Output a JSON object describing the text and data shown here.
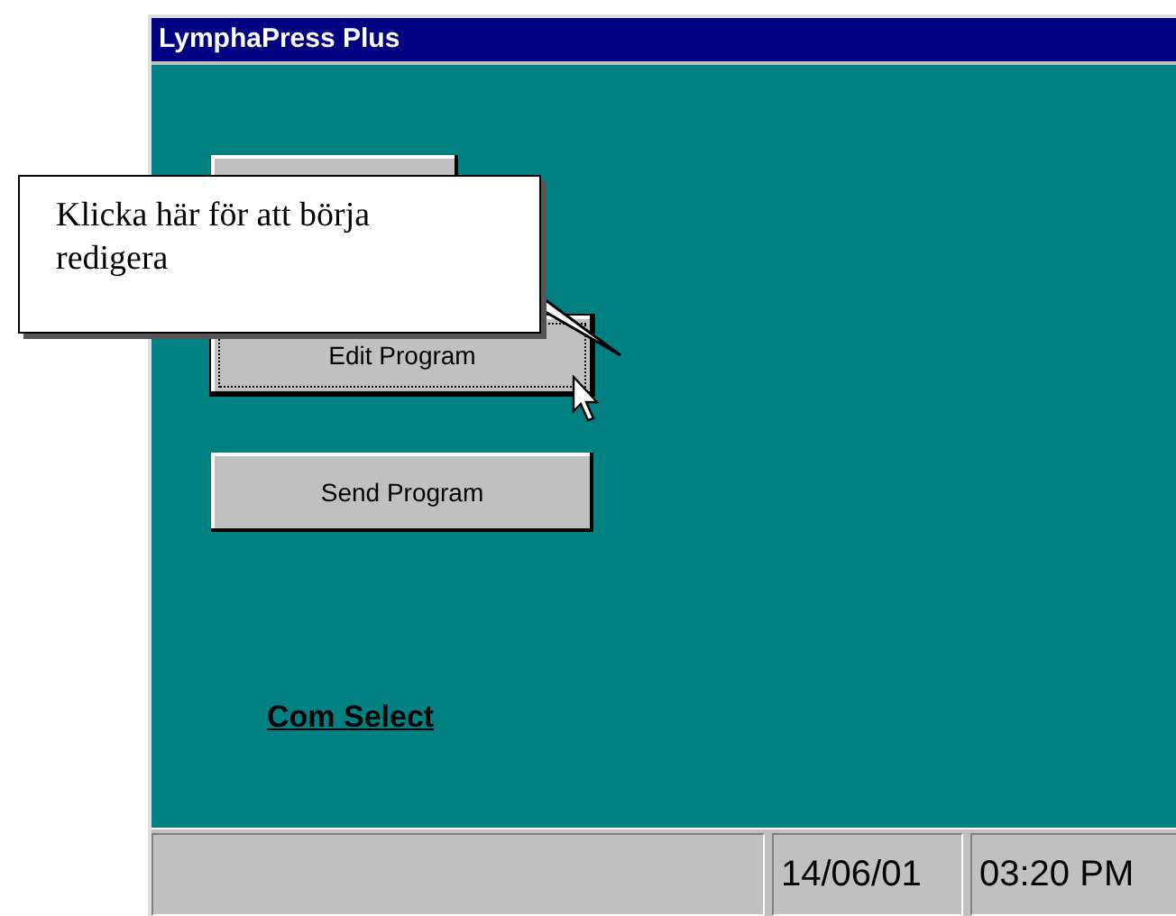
{
  "window": {
    "title": "LymphaPress Plus"
  },
  "buttons": [
    {
      "focused": false
    },
    {
      "label": "Edit Program",
      "focused": true
    },
    {
      "label": "Send Program",
      "focused": false
    }
  ],
  "link": "Com Select",
  "callout": {
    "text": "Klicka här för att börja redigera"
  },
  "status_bar": {
    "date": "14/06/01",
    "time": "03:20 PM"
  }
}
